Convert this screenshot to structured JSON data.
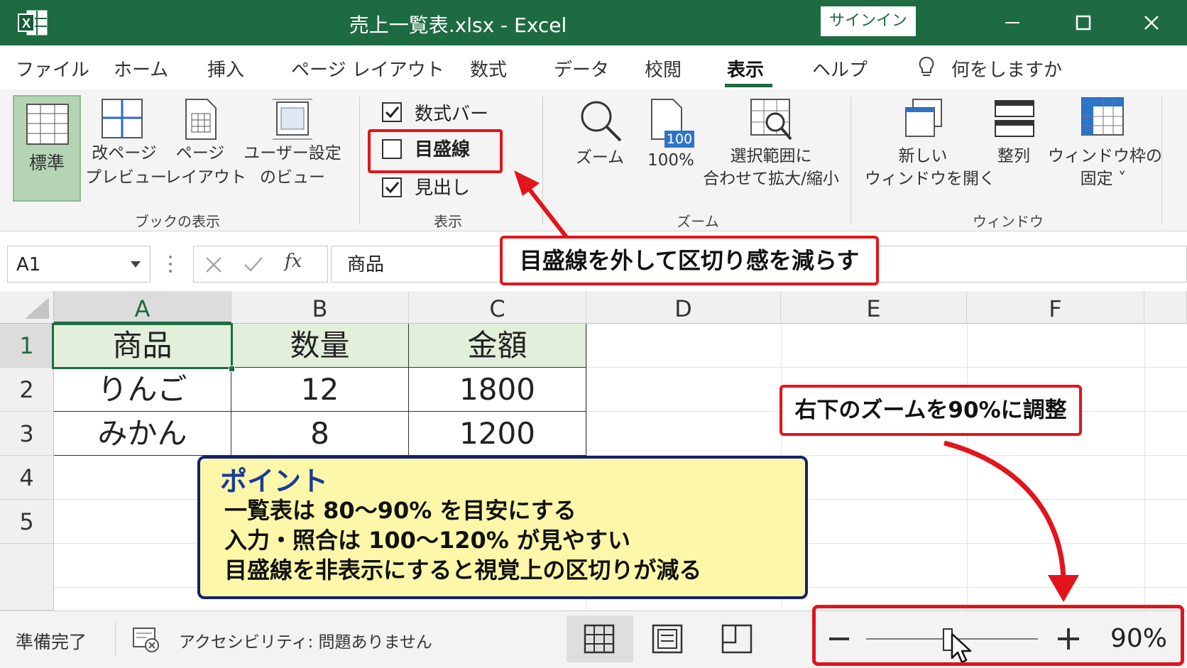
{
  "window": {
    "title": "売上一覧表.xlsx  -  Excel",
    "signin_label": "サインイン"
  },
  "menu": {
    "items": [
      "ファイル",
      "ホーム",
      "挿入",
      "ページ レイアウト",
      "数式",
      "データ",
      "校閲",
      "表示",
      "ヘルプ"
    ],
    "active": "表示",
    "tell_me": "何をしますか"
  },
  "ribbon": {
    "book_view": {
      "normal": "標準",
      "page_break_1": "改ページ",
      "page_break_2": "プレビュー",
      "page_layout_1": "ページ",
      "page_layout_2": "レイアウト",
      "custom_1": "ユーザー設定",
      "custom_2": "のビュー",
      "group_label": "ブックの表示"
    },
    "show": {
      "formula_bar": "数式バー",
      "formula_bar_checked": true,
      "gridlines": "目盛線",
      "gridlines_checked": false,
      "headings": "見出し",
      "headings_checked": true,
      "group_label": "表示"
    },
    "zoom": {
      "zoom": "ズーム",
      "hundred": "100%",
      "hundred_badge": "100",
      "selection_1": "選択範囲に",
      "selection_2": "合わせて拡大/縮小",
      "group_label": "ズーム"
    },
    "window": {
      "new_window_1": "新しい",
      "new_window_2": "ウィンドウを開く",
      "arrange": "整列",
      "freeze_1": "ウィンドウ枠の",
      "freeze_2": "固定 ˅",
      "group_label": "ウィンドウ"
    }
  },
  "formula_bar": {
    "name_box": "A1",
    "fx": "fx",
    "content": "商品"
  },
  "sheet": {
    "columns": [
      "A",
      "B",
      "C",
      "D",
      "E",
      "F"
    ],
    "rows": [
      "1",
      "2",
      "3",
      "4",
      "5"
    ],
    "cells": [
      [
        "商品",
        "数量",
        "金額"
      ],
      [
        "りんご",
        "12",
        "1800"
      ],
      [
        "みかん",
        "8",
        "1200"
      ]
    ]
  },
  "annotations": {
    "gridlines_callout": "目盛線を外して区切り感を減らす",
    "zoom_callout": "右下のズームを90%に調整",
    "point_title": "ポイント",
    "point_lines": [
      "一覧表は 80〜90% を目安にする",
      "入力・照合は 100〜120% が見やすい",
      "目盛線を非表示にすると視覚上の区切りが減る"
    ]
  },
  "status": {
    "ready": "準備完了",
    "accessibility": "アクセシビリティ: 問題ありません",
    "zoom_level": "90%",
    "zoom_value": 0.9
  },
  "colors": {
    "excel_green": "#1e6b41",
    "callout_red": "#e3141b",
    "point_bg": "#fdf8a9",
    "point_border": "#14216b"
  }
}
